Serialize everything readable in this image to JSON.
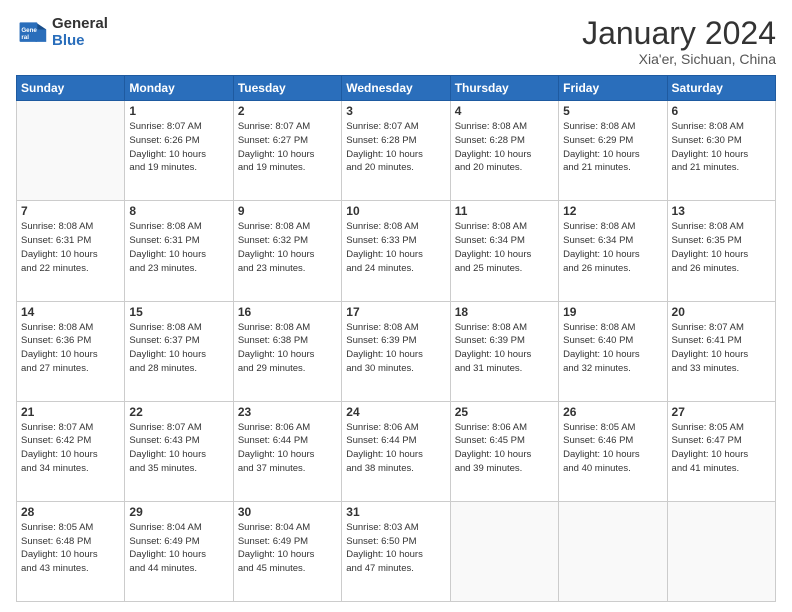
{
  "logo": {
    "general": "General",
    "blue": "Blue"
  },
  "title": "January 2024",
  "subtitle": "Xia'er, Sichuan, China",
  "days_of_week": [
    "Sunday",
    "Monday",
    "Tuesday",
    "Wednesday",
    "Thursday",
    "Friday",
    "Saturday"
  ],
  "weeks": [
    [
      {
        "day": "",
        "info": ""
      },
      {
        "day": "1",
        "info": "Sunrise: 8:07 AM\nSunset: 6:26 PM\nDaylight: 10 hours\nand 19 minutes."
      },
      {
        "day": "2",
        "info": "Sunrise: 8:07 AM\nSunset: 6:27 PM\nDaylight: 10 hours\nand 19 minutes."
      },
      {
        "day": "3",
        "info": "Sunrise: 8:07 AM\nSunset: 6:28 PM\nDaylight: 10 hours\nand 20 minutes."
      },
      {
        "day": "4",
        "info": "Sunrise: 8:08 AM\nSunset: 6:28 PM\nDaylight: 10 hours\nand 20 minutes."
      },
      {
        "day": "5",
        "info": "Sunrise: 8:08 AM\nSunset: 6:29 PM\nDaylight: 10 hours\nand 21 minutes."
      },
      {
        "day": "6",
        "info": "Sunrise: 8:08 AM\nSunset: 6:30 PM\nDaylight: 10 hours\nand 21 minutes."
      }
    ],
    [
      {
        "day": "7",
        "info": "Sunrise: 8:08 AM\nSunset: 6:31 PM\nDaylight: 10 hours\nand 22 minutes."
      },
      {
        "day": "8",
        "info": "Sunrise: 8:08 AM\nSunset: 6:31 PM\nDaylight: 10 hours\nand 23 minutes."
      },
      {
        "day": "9",
        "info": "Sunrise: 8:08 AM\nSunset: 6:32 PM\nDaylight: 10 hours\nand 23 minutes."
      },
      {
        "day": "10",
        "info": "Sunrise: 8:08 AM\nSunset: 6:33 PM\nDaylight: 10 hours\nand 24 minutes."
      },
      {
        "day": "11",
        "info": "Sunrise: 8:08 AM\nSunset: 6:34 PM\nDaylight: 10 hours\nand 25 minutes."
      },
      {
        "day": "12",
        "info": "Sunrise: 8:08 AM\nSunset: 6:34 PM\nDaylight: 10 hours\nand 26 minutes."
      },
      {
        "day": "13",
        "info": "Sunrise: 8:08 AM\nSunset: 6:35 PM\nDaylight: 10 hours\nand 26 minutes."
      }
    ],
    [
      {
        "day": "14",
        "info": "Sunrise: 8:08 AM\nSunset: 6:36 PM\nDaylight: 10 hours\nand 27 minutes."
      },
      {
        "day": "15",
        "info": "Sunrise: 8:08 AM\nSunset: 6:37 PM\nDaylight: 10 hours\nand 28 minutes."
      },
      {
        "day": "16",
        "info": "Sunrise: 8:08 AM\nSunset: 6:38 PM\nDaylight: 10 hours\nand 29 minutes."
      },
      {
        "day": "17",
        "info": "Sunrise: 8:08 AM\nSunset: 6:39 PM\nDaylight: 10 hours\nand 30 minutes."
      },
      {
        "day": "18",
        "info": "Sunrise: 8:08 AM\nSunset: 6:39 PM\nDaylight: 10 hours\nand 31 minutes."
      },
      {
        "day": "19",
        "info": "Sunrise: 8:08 AM\nSunset: 6:40 PM\nDaylight: 10 hours\nand 32 minutes."
      },
      {
        "day": "20",
        "info": "Sunrise: 8:07 AM\nSunset: 6:41 PM\nDaylight: 10 hours\nand 33 minutes."
      }
    ],
    [
      {
        "day": "21",
        "info": "Sunrise: 8:07 AM\nSunset: 6:42 PM\nDaylight: 10 hours\nand 34 minutes."
      },
      {
        "day": "22",
        "info": "Sunrise: 8:07 AM\nSunset: 6:43 PM\nDaylight: 10 hours\nand 35 minutes."
      },
      {
        "day": "23",
        "info": "Sunrise: 8:06 AM\nSunset: 6:44 PM\nDaylight: 10 hours\nand 37 minutes."
      },
      {
        "day": "24",
        "info": "Sunrise: 8:06 AM\nSunset: 6:44 PM\nDaylight: 10 hours\nand 38 minutes."
      },
      {
        "day": "25",
        "info": "Sunrise: 8:06 AM\nSunset: 6:45 PM\nDaylight: 10 hours\nand 39 minutes."
      },
      {
        "day": "26",
        "info": "Sunrise: 8:05 AM\nSunset: 6:46 PM\nDaylight: 10 hours\nand 40 minutes."
      },
      {
        "day": "27",
        "info": "Sunrise: 8:05 AM\nSunset: 6:47 PM\nDaylight: 10 hours\nand 41 minutes."
      }
    ],
    [
      {
        "day": "28",
        "info": "Sunrise: 8:05 AM\nSunset: 6:48 PM\nDaylight: 10 hours\nand 43 minutes."
      },
      {
        "day": "29",
        "info": "Sunrise: 8:04 AM\nSunset: 6:49 PM\nDaylight: 10 hours\nand 44 minutes."
      },
      {
        "day": "30",
        "info": "Sunrise: 8:04 AM\nSunset: 6:49 PM\nDaylight: 10 hours\nand 45 minutes."
      },
      {
        "day": "31",
        "info": "Sunrise: 8:03 AM\nSunset: 6:50 PM\nDaylight: 10 hours\nand 47 minutes."
      },
      {
        "day": "",
        "info": ""
      },
      {
        "day": "",
        "info": ""
      },
      {
        "day": "",
        "info": ""
      }
    ]
  ]
}
